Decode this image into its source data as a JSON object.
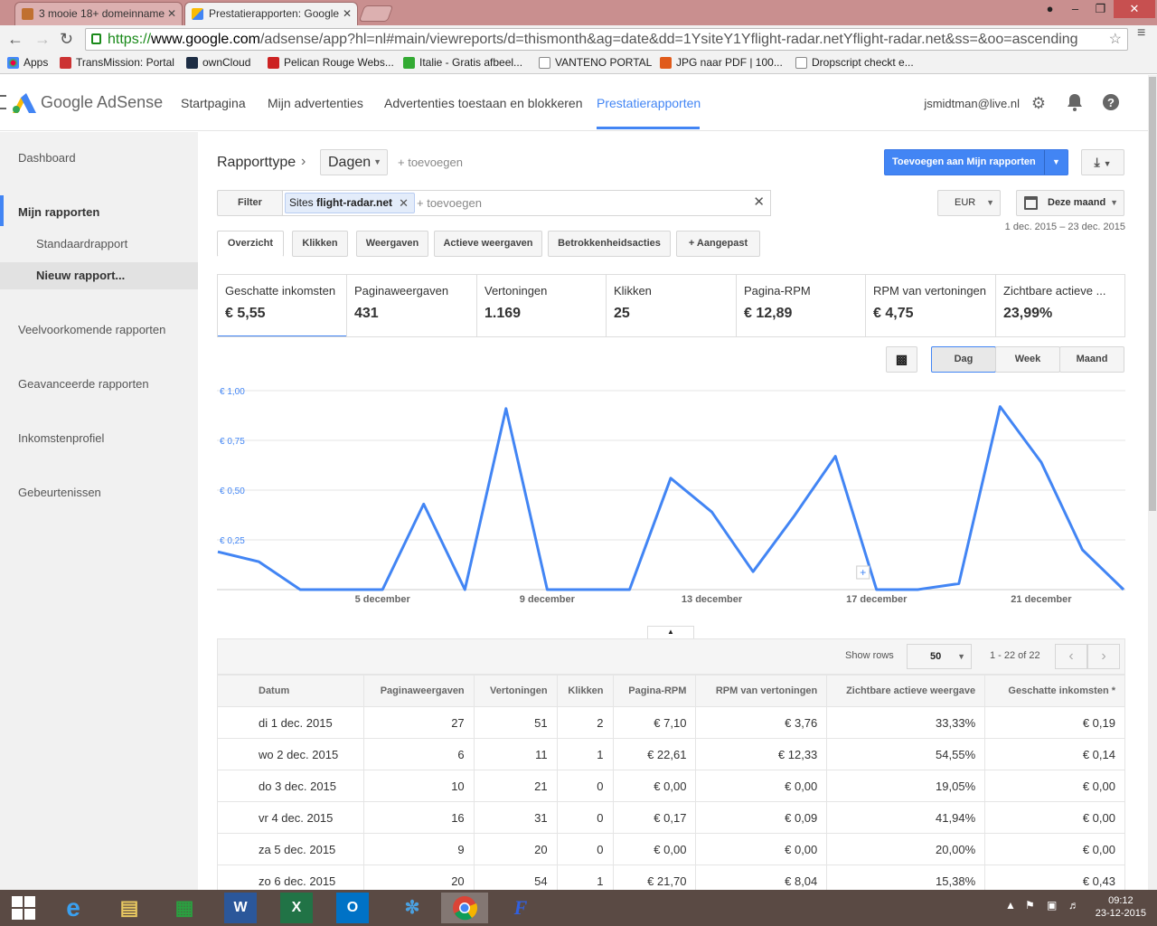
{
  "browser": {
    "tabs": [
      {
        "title": "3 mooie 18+ domeinname",
        "close": "✕"
      },
      {
        "title": "Prestatierapporten: Google",
        "close": "✕"
      }
    ],
    "url_scheme": "https://",
    "url_host": "www.google.com",
    "url_path": "/adsense/app?hl=nl#main/viewreports/d=thismonth&ag=date&dd=1YsiteY1Yflight-radar.netYflight-radar.net&ss=&oo=ascending",
    "bookmarks": [
      "Apps",
      "TransMission: Portal",
      "ownCloud",
      "Pelican Rouge Webs...",
      "Italie - Gratis afbeel...",
      "VANTENO PORTAL",
      "JPG naar PDF | 100...",
      "Dropscript checkt e..."
    ]
  },
  "header": {
    "brand": "Google AdSense",
    "nav": [
      "Startpagina",
      "Mijn advertenties",
      "Advertenties toestaan en blokkeren",
      "Prestatierapporten"
    ],
    "user": "jsmidtman@live.nl"
  },
  "sidebar": {
    "items": [
      "Dashboard",
      "Mijn rapporten",
      "Standaardrapport",
      "Nieuw rapport...",
      "Veelvoorkomende rapporten",
      "Geavanceerde rapporten",
      "Inkomstenprofiel",
      "Gebeurtenissen"
    ]
  },
  "report": {
    "type_label": "Rapporttype",
    "type_value": "Dagen",
    "add": "+ toevoegen",
    "add_button": "Toevoegen aan Mijn rapporten",
    "filter_label": "Filter",
    "filter_chip_key": "Sites",
    "filter_chip_value": "flight-radar.net",
    "filter_add": "+ toevoegen",
    "currency": "EUR",
    "period": "Deze maand",
    "date_range": "1 dec. 2015 – 23 dec. 2015",
    "tabs": [
      "Overzicht",
      "Klikken",
      "Weergaven",
      "Actieve weergaven",
      "Betrokkenheidsacties",
      "+ Aangepast"
    ],
    "granularity": [
      "Dag",
      "Week",
      "Maand"
    ]
  },
  "cards": [
    {
      "title": "Geschatte inkomsten",
      "value": "€ 5,55"
    },
    {
      "title": "Paginaweergaven",
      "value": "431"
    },
    {
      "title": "Vertoningen",
      "value": "1.169"
    },
    {
      "title": "Klikken",
      "value": "25"
    },
    {
      "title": "Pagina-RPM",
      "value": "€ 12,89"
    },
    {
      "title": "RPM van vertoningen",
      "value": "€ 4,75"
    },
    {
      "title": "Zichtbare actieve ...",
      "value": "23,99%"
    }
  ],
  "chart_data": {
    "type": "line",
    "x": [
      "1 dec.",
      "2 dec.",
      "3 dec.",
      "4 dec.",
      "5 december",
      "6 dec.",
      "7 dec.",
      "8 dec.",
      "9 december",
      "10 dec.",
      "11 dec.",
      "12 dec.",
      "13 december",
      "14 dec.",
      "15 dec.",
      "16 dec.",
      "17 december",
      "18 dec.",
      "19 dec.",
      "20 dec.",
      "21 december",
      "22 dec.",
      "23 dec."
    ],
    "series": [
      {
        "values": [
          0.19,
          0.14,
          0,
          0,
          0,
          0.43,
          0,
          0.91,
          0,
          0,
          0,
          0.56,
          0.39,
          0.09,
          0.37,
          0.67,
          0,
          0,
          0.03,
          0.92,
          0.64,
          0.2,
          0
        ]
      }
    ],
    "y_ticks": [
      "€ 0,25",
      "€ 0,50",
      "€ 0,75",
      "€ 1,00"
    ],
    "x_ticks": [
      "5 december",
      "9 december",
      "13 december",
      "17 december",
      "21 december"
    ],
    "ylim": [
      0,
      1.0
    ],
    "color": "#4285f4",
    "grid": true
  },
  "table": {
    "show_rows_label": "Show rows",
    "rows_value": "50",
    "pager": "1 - 22 of 22",
    "headers": [
      "Datum",
      "Paginaweergaven",
      "Vertoningen",
      "Klikken",
      "Pagina-RPM",
      "RPM van vertoningen",
      "Zichtbare actieve weergave",
      "Geschatte inkomsten *"
    ],
    "rows": [
      [
        "di 1 dec. 2015",
        "27",
        "51",
        "2",
        "€ 7,10",
        "€ 3,76",
        "33,33%",
        "€ 0,19"
      ],
      [
        "wo 2 dec. 2015",
        "6",
        "11",
        "1",
        "€ 22,61",
        "€ 12,33",
        "54,55%",
        "€ 0,14"
      ],
      [
        "do 3 dec. 2015",
        "10",
        "21",
        "0",
        "€ 0,00",
        "€ 0,00",
        "19,05%",
        "€ 0,00"
      ],
      [
        "vr 4 dec. 2015",
        "16",
        "31",
        "0",
        "€ 0,17",
        "€ 0,09",
        "41,94%",
        "€ 0,00"
      ],
      [
        "za 5 dec. 2015",
        "9",
        "20",
        "0",
        "€ 0,00",
        "€ 0,00",
        "20,00%",
        "€ 0,00"
      ],
      [
        "zo 6 dec. 2015",
        "20",
        "54",
        "1",
        "€ 21,70",
        "€ 8,04",
        "15,38%",
        "€ 0,43"
      ]
    ]
  },
  "taskbar": {
    "time": "09:12",
    "date": "23-12-2015"
  }
}
